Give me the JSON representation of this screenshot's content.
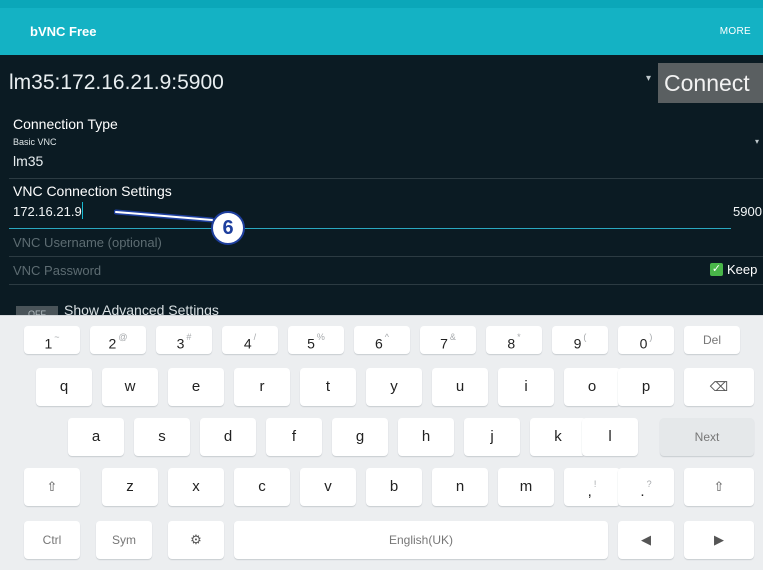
{
  "app": {
    "title": "bVNC Free",
    "more_label": "MORE"
  },
  "connection": {
    "selected": "lm35:172.16.21.9:5900",
    "connect_label": "Connect",
    "type_label": "Connection Type",
    "type_value": "Basic VNC",
    "nickname": "lm35"
  },
  "vnc": {
    "section_label": "VNC Connection Settings",
    "host": "172.16.21.9",
    "port": "5900",
    "username_placeholder": "VNC Username (optional)",
    "password_placeholder": "VNC Password",
    "keep_label": "Keep"
  },
  "advanced": {
    "toggle_label": "OFF",
    "label": "Show Advanced Settings"
  },
  "annotation": {
    "number": "6"
  },
  "keyboard": {
    "row_numbers": [
      {
        "k": "1",
        "s": "~"
      },
      {
        "k": "2",
        "s": "@"
      },
      {
        "k": "3",
        "s": "#"
      },
      {
        "k": "4",
        "s": "/"
      },
      {
        "k": "5",
        "s": "%"
      },
      {
        "k": "6",
        "s": "^"
      },
      {
        "k": "7",
        "s": "&"
      },
      {
        "k": "8",
        "s": "*"
      },
      {
        "k": "9",
        "s": "("
      },
      {
        "k": "0",
        "s": ")"
      }
    ],
    "del_label": "Del",
    "row1": [
      "q",
      "w",
      "e",
      "r",
      "t",
      "y",
      "u",
      "i",
      "o",
      "p"
    ],
    "row2": [
      "a",
      "s",
      "d",
      "f",
      "g",
      "h",
      "j",
      "k",
      "l"
    ],
    "next_label": "Next",
    "row3": [
      "z",
      "x",
      "c",
      "v",
      "b",
      "n",
      "m"
    ],
    "comma": {
      "k": ",",
      "s": "!"
    },
    "period": {
      "k": ".",
      "s": "?"
    },
    "ctrl_label": "Ctrl",
    "sym_label": "Sym",
    "space_label": "English(UK)"
  }
}
